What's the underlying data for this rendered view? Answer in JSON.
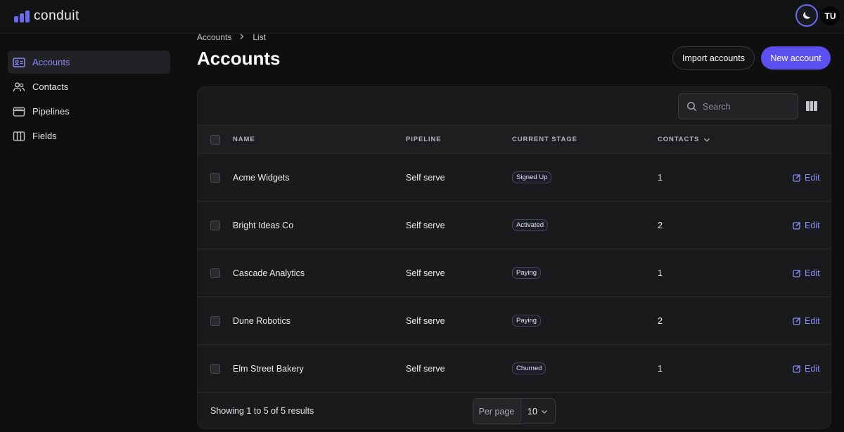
{
  "app": {
    "name": "conduit"
  },
  "colors": {
    "accent": "#5c4ff0",
    "accent_text": "#8c8af7",
    "background": "#0f0f10",
    "surface": "#1a1a1c"
  },
  "header": {
    "avatar_initials": "TU",
    "theme_icon": "moon-icon"
  },
  "sidebar": {
    "items": [
      {
        "label": "Accounts",
        "icon": "id-card-icon",
        "active": true
      },
      {
        "label": "Contacts",
        "icon": "users-icon",
        "active": false
      },
      {
        "label": "Pipelines",
        "icon": "inbox-icon",
        "active": false
      },
      {
        "label": "Fields",
        "icon": "columns-icon",
        "active": false
      }
    ]
  },
  "breadcrumb": {
    "items": [
      "Accounts",
      "List"
    ]
  },
  "page": {
    "title": "Accounts"
  },
  "actions": {
    "import_label": "Import accounts",
    "new_label": "New account"
  },
  "table": {
    "search_placeholder": "Search",
    "columns": {
      "name": "NAME",
      "pipeline": "PIPELINE",
      "stage": "CURRENT STAGE",
      "contacts": "CONTACTS"
    },
    "sort": {
      "column": "contacts",
      "direction": "desc"
    },
    "edit_label": "Edit",
    "rows": [
      {
        "name": "Acme Widgets",
        "pipeline": "Self serve",
        "stage": "Signed Up",
        "contacts": "1"
      },
      {
        "name": "Bright Ideas Co",
        "pipeline": "Self serve",
        "stage": "Activated",
        "contacts": "2"
      },
      {
        "name": "Cascade Analytics",
        "pipeline": "Self serve",
        "stage": "Paying",
        "contacts": "1"
      },
      {
        "name": "Dune Robotics",
        "pipeline": "Self serve",
        "stage": "Paying",
        "contacts": "2"
      },
      {
        "name": "Elm Street Bakery",
        "pipeline": "Self serve",
        "stage": "Churned",
        "contacts": "1"
      }
    ]
  },
  "pagination": {
    "summary": "Showing 1 to 5 of 5 results",
    "per_page_label": "Per page",
    "per_page_value": "10"
  }
}
